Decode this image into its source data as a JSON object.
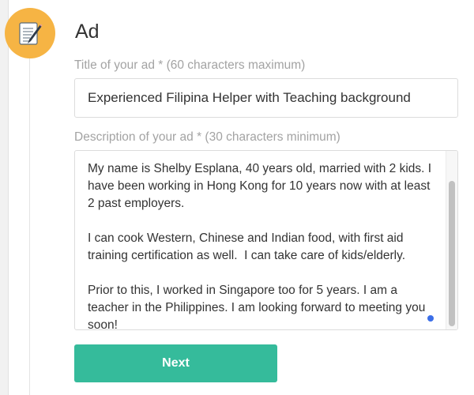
{
  "section": {
    "title": "Ad",
    "icon": "notepad-pencil-icon",
    "badge_color": "#f6b444"
  },
  "title_field": {
    "label": "Title of your ad * (60 characters maximum)",
    "value": "Experienced Filipina Helper with Teaching background"
  },
  "description_field": {
    "label": "Description of your ad * (30 characters minimum)",
    "value": "My name is Shelby Esplana, 40 years old, married with 2 kids. I have been working in Hong Kong for 10 years now with at least 2 past employers.\n\nI can cook Western, Chinese and Indian food, with first aid training certification as well.  I can take care of kids/elderly.\n\nPrior to this, I worked in Singapore too for 5 years. I am a teacher in the Philippines. I am looking forward to meeting you soon!"
  },
  "actions": {
    "next_label": "Next",
    "button_color": "#35bb9b"
  }
}
